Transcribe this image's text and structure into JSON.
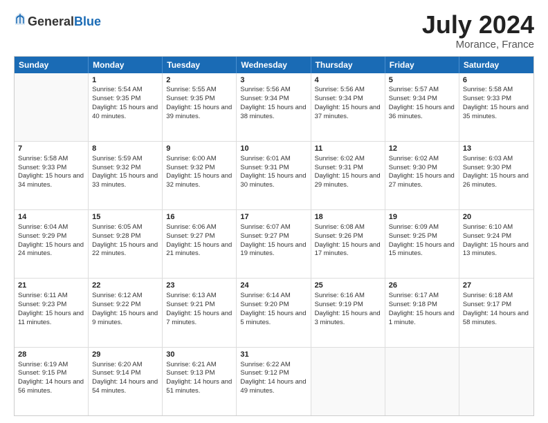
{
  "header": {
    "logo_general": "General",
    "logo_blue": "Blue",
    "month_title": "July 2024",
    "location": "Morance, France"
  },
  "calendar": {
    "days": [
      "Sunday",
      "Monday",
      "Tuesday",
      "Wednesday",
      "Thursday",
      "Friday",
      "Saturday"
    ],
    "rows": [
      [
        {
          "day": "",
          "sunrise": "",
          "sunset": "",
          "daylight": ""
        },
        {
          "day": "1",
          "sunrise": "Sunrise: 5:54 AM",
          "sunset": "Sunset: 9:35 PM",
          "daylight": "Daylight: 15 hours and 40 minutes."
        },
        {
          "day": "2",
          "sunrise": "Sunrise: 5:55 AM",
          "sunset": "Sunset: 9:35 PM",
          "daylight": "Daylight: 15 hours and 39 minutes."
        },
        {
          "day": "3",
          "sunrise": "Sunrise: 5:56 AM",
          "sunset": "Sunset: 9:34 PM",
          "daylight": "Daylight: 15 hours and 38 minutes."
        },
        {
          "day": "4",
          "sunrise": "Sunrise: 5:56 AM",
          "sunset": "Sunset: 9:34 PM",
          "daylight": "Daylight: 15 hours and 37 minutes."
        },
        {
          "day": "5",
          "sunrise": "Sunrise: 5:57 AM",
          "sunset": "Sunset: 9:34 PM",
          "daylight": "Daylight: 15 hours and 36 minutes."
        },
        {
          "day": "6",
          "sunrise": "Sunrise: 5:58 AM",
          "sunset": "Sunset: 9:33 PM",
          "daylight": "Daylight: 15 hours and 35 minutes."
        }
      ],
      [
        {
          "day": "7",
          "sunrise": "Sunrise: 5:58 AM",
          "sunset": "Sunset: 9:33 PM",
          "daylight": "Daylight: 15 hours and 34 minutes."
        },
        {
          "day": "8",
          "sunrise": "Sunrise: 5:59 AM",
          "sunset": "Sunset: 9:32 PM",
          "daylight": "Daylight: 15 hours and 33 minutes."
        },
        {
          "day": "9",
          "sunrise": "Sunrise: 6:00 AM",
          "sunset": "Sunset: 9:32 PM",
          "daylight": "Daylight: 15 hours and 32 minutes."
        },
        {
          "day": "10",
          "sunrise": "Sunrise: 6:01 AM",
          "sunset": "Sunset: 9:31 PM",
          "daylight": "Daylight: 15 hours and 30 minutes."
        },
        {
          "day": "11",
          "sunrise": "Sunrise: 6:02 AM",
          "sunset": "Sunset: 9:31 PM",
          "daylight": "Daylight: 15 hours and 29 minutes."
        },
        {
          "day": "12",
          "sunrise": "Sunrise: 6:02 AM",
          "sunset": "Sunset: 9:30 PM",
          "daylight": "Daylight: 15 hours and 27 minutes."
        },
        {
          "day": "13",
          "sunrise": "Sunrise: 6:03 AM",
          "sunset": "Sunset: 9:30 PM",
          "daylight": "Daylight: 15 hours and 26 minutes."
        }
      ],
      [
        {
          "day": "14",
          "sunrise": "Sunrise: 6:04 AM",
          "sunset": "Sunset: 9:29 PM",
          "daylight": "Daylight: 15 hours and 24 minutes."
        },
        {
          "day": "15",
          "sunrise": "Sunrise: 6:05 AM",
          "sunset": "Sunset: 9:28 PM",
          "daylight": "Daylight: 15 hours and 22 minutes."
        },
        {
          "day": "16",
          "sunrise": "Sunrise: 6:06 AM",
          "sunset": "Sunset: 9:27 PM",
          "daylight": "Daylight: 15 hours and 21 minutes."
        },
        {
          "day": "17",
          "sunrise": "Sunrise: 6:07 AM",
          "sunset": "Sunset: 9:27 PM",
          "daylight": "Daylight: 15 hours and 19 minutes."
        },
        {
          "day": "18",
          "sunrise": "Sunrise: 6:08 AM",
          "sunset": "Sunset: 9:26 PM",
          "daylight": "Daylight: 15 hours and 17 minutes."
        },
        {
          "day": "19",
          "sunrise": "Sunrise: 6:09 AM",
          "sunset": "Sunset: 9:25 PM",
          "daylight": "Daylight: 15 hours and 15 minutes."
        },
        {
          "day": "20",
          "sunrise": "Sunrise: 6:10 AM",
          "sunset": "Sunset: 9:24 PM",
          "daylight": "Daylight: 15 hours and 13 minutes."
        }
      ],
      [
        {
          "day": "21",
          "sunrise": "Sunrise: 6:11 AM",
          "sunset": "Sunset: 9:23 PM",
          "daylight": "Daylight: 15 hours and 11 minutes."
        },
        {
          "day": "22",
          "sunrise": "Sunrise: 6:12 AM",
          "sunset": "Sunset: 9:22 PM",
          "daylight": "Daylight: 15 hours and 9 minutes."
        },
        {
          "day": "23",
          "sunrise": "Sunrise: 6:13 AM",
          "sunset": "Sunset: 9:21 PM",
          "daylight": "Daylight: 15 hours and 7 minutes."
        },
        {
          "day": "24",
          "sunrise": "Sunrise: 6:14 AM",
          "sunset": "Sunset: 9:20 PM",
          "daylight": "Daylight: 15 hours and 5 minutes."
        },
        {
          "day": "25",
          "sunrise": "Sunrise: 6:16 AM",
          "sunset": "Sunset: 9:19 PM",
          "daylight": "Daylight: 15 hours and 3 minutes."
        },
        {
          "day": "26",
          "sunrise": "Sunrise: 6:17 AM",
          "sunset": "Sunset: 9:18 PM",
          "daylight": "Daylight: 15 hours and 1 minute."
        },
        {
          "day": "27",
          "sunrise": "Sunrise: 6:18 AM",
          "sunset": "Sunset: 9:17 PM",
          "daylight": "Daylight: 14 hours and 58 minutes."
        }
      ],
      [
        {
          "day": "28",
          "sunrise": "Sunrise: 6:19 AM",
          "sunset": "Sunset: 9:15 PM",
          "daylight": "Daylight: 14 hours and 56 minutes."
        },
        {
          "day": "29",
          "sunrise": "Sunrise: 6:20 AM",
          "sunset": "Sunset: 9:14 PM",
          "daylight": "Daylight: 14 hours and 54 minutes."
        },
        {
          "day": "30",
          "sunrise": "Sunrise: 6:21 AM",
          "sunset": "Sunset: 9:13 PM",
          "daylight": "Daylight: 14 hours and 51 minutes."
        },
        {
          "day": "31",
          "sunrise": "Sunrise: 6:22 AM",
          "sunset": "Sunset: 9:12 PM",
          "daylight": "Daylight: 14 hours and 49 minutes."
        },
        {
          "day": "",
          "sunrise": "",
          "sunset": "",
          "daylight": ""
        },
        {
          "day": "",
          "sunrise": "",
          "sunset": "",
          "daylight": ""
        },
        {
          "day": "",
          "sunrise": "",
          "sunset": "",
          "daylight": ""
        }
      ]
    ]
  }
}
